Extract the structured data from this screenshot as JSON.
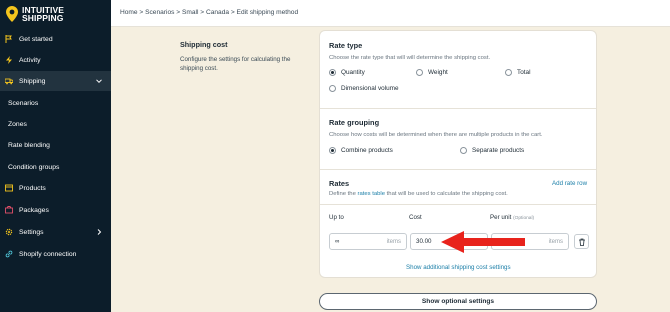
{
  "brand": {
    "line1": "INTUITIVE",
    "line2": "SHIPPING"
  },
  "sidebar": {
    "items": [
      {
        "label": "Get started",
        "icon": "flag-icon"
      },
      {
        "label": "Activity",
        "icon": "bolt-icon"
      },
      {
        "label": "Shipping",
        "icon": "truck-icon"
      },
      {
        "label": "Scenarios"
      },
      {
        "label": "Zones"
      },
      {
        "label": "Rate blending"
      },
      {
        "label": "Condition groups"
      },
      {
        "label": "Products",
        "icon": "box-icon"
      },
      {
        "label": "Packages",
        "icon": "package-icon"
      },
      {
        "label": "Settings",
        "icon": "gear-icon"
      },
      {
        "label": "Shopify connection",
        "icon": "link-icon"
      }
    ]
  },
  "breadcrumb": "Home > Scenarios > Small > Canada > Edit shipping method",
  "shipping_cost": {
    "title": "Shipping cost",
    "description": "Configure the settings for calculating the shipping cost."
  },
  "rate_type": {
    "title": "Rate type",
    "description": "Choose the rate type that will will determine the shipping cost.",
    "options": [
      "Quantity",
      "Weight",
      "Total",
      "Dimensional volume"
    ],
    "selected": "Quantity"
  },
  "rate_grouping": {
    "title": "Rate grouping",
    "description": "Choose how costs will be determined when there are multiple products in the cart.",
    "options": [
      "Combine products",
      "Separate products"
    ],
    "selected": "Combine products"
  },
  "rates": {
    "title": "Rates",
    "description_before": "Define the ",
    "description_link": "rates table",
    "description_after": " that will be used to calculate the shipping cost.",
    "add_label": "Add rate row",
    "columns": {
      "up_to": "Up to",
      "cost": "Cost",
      "per_unit": "Per unit",
      "per_unit_hint": "(Optional)"
    },
    "row": {
      "up_to": "∞",
      "up_to_suffix": "items",
      "cost": "30.00",
      "per_unit_placeholder": "unit",
      "per_unit_suffix": "items"
    },
    "show_additional": "Show additional shipping cost settings"
  },
  "optional_button": "Show optional settings",
  "colors": {
    "sidebar": "#0c1d2a",
    "accent": "#1c7fa8",
    "arrow": "#e8231c",
    "brand_yellow": "#f4c51d"
  }
}
